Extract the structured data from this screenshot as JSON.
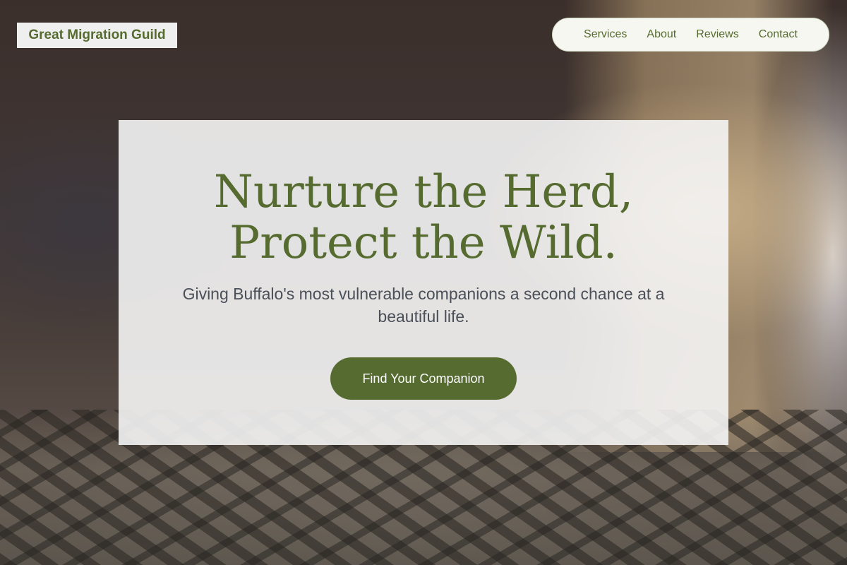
{
  "brand": {
    "name": "Great Migration Guild"
  },
  "nav": {
    "items": [
      {
        "label": "Services"
      },
      {
        "label": "About"
      },
      {
        "label": "Reviews"
      },
      {
        "label": "Contact"
      }
    ]
  },
  "hero": {
    "headline_line1": "Nurture the Herd,",
    "headline_line2": "Protect the Wild.",
    "subtitle": "Giving Buffalo's most vulnerable companions a second chance at a beautiful life.",
    "cta_label": "Find Your Companion",
    "background_image": "tabby-cat-photo"
  },
  "colors": {
    "accent": "#556b2f",
    "card_background": "#f5f5f5",
    "subtitle_text": "#4a4f58",
    "button_text": "#ffffff"
  }
}
